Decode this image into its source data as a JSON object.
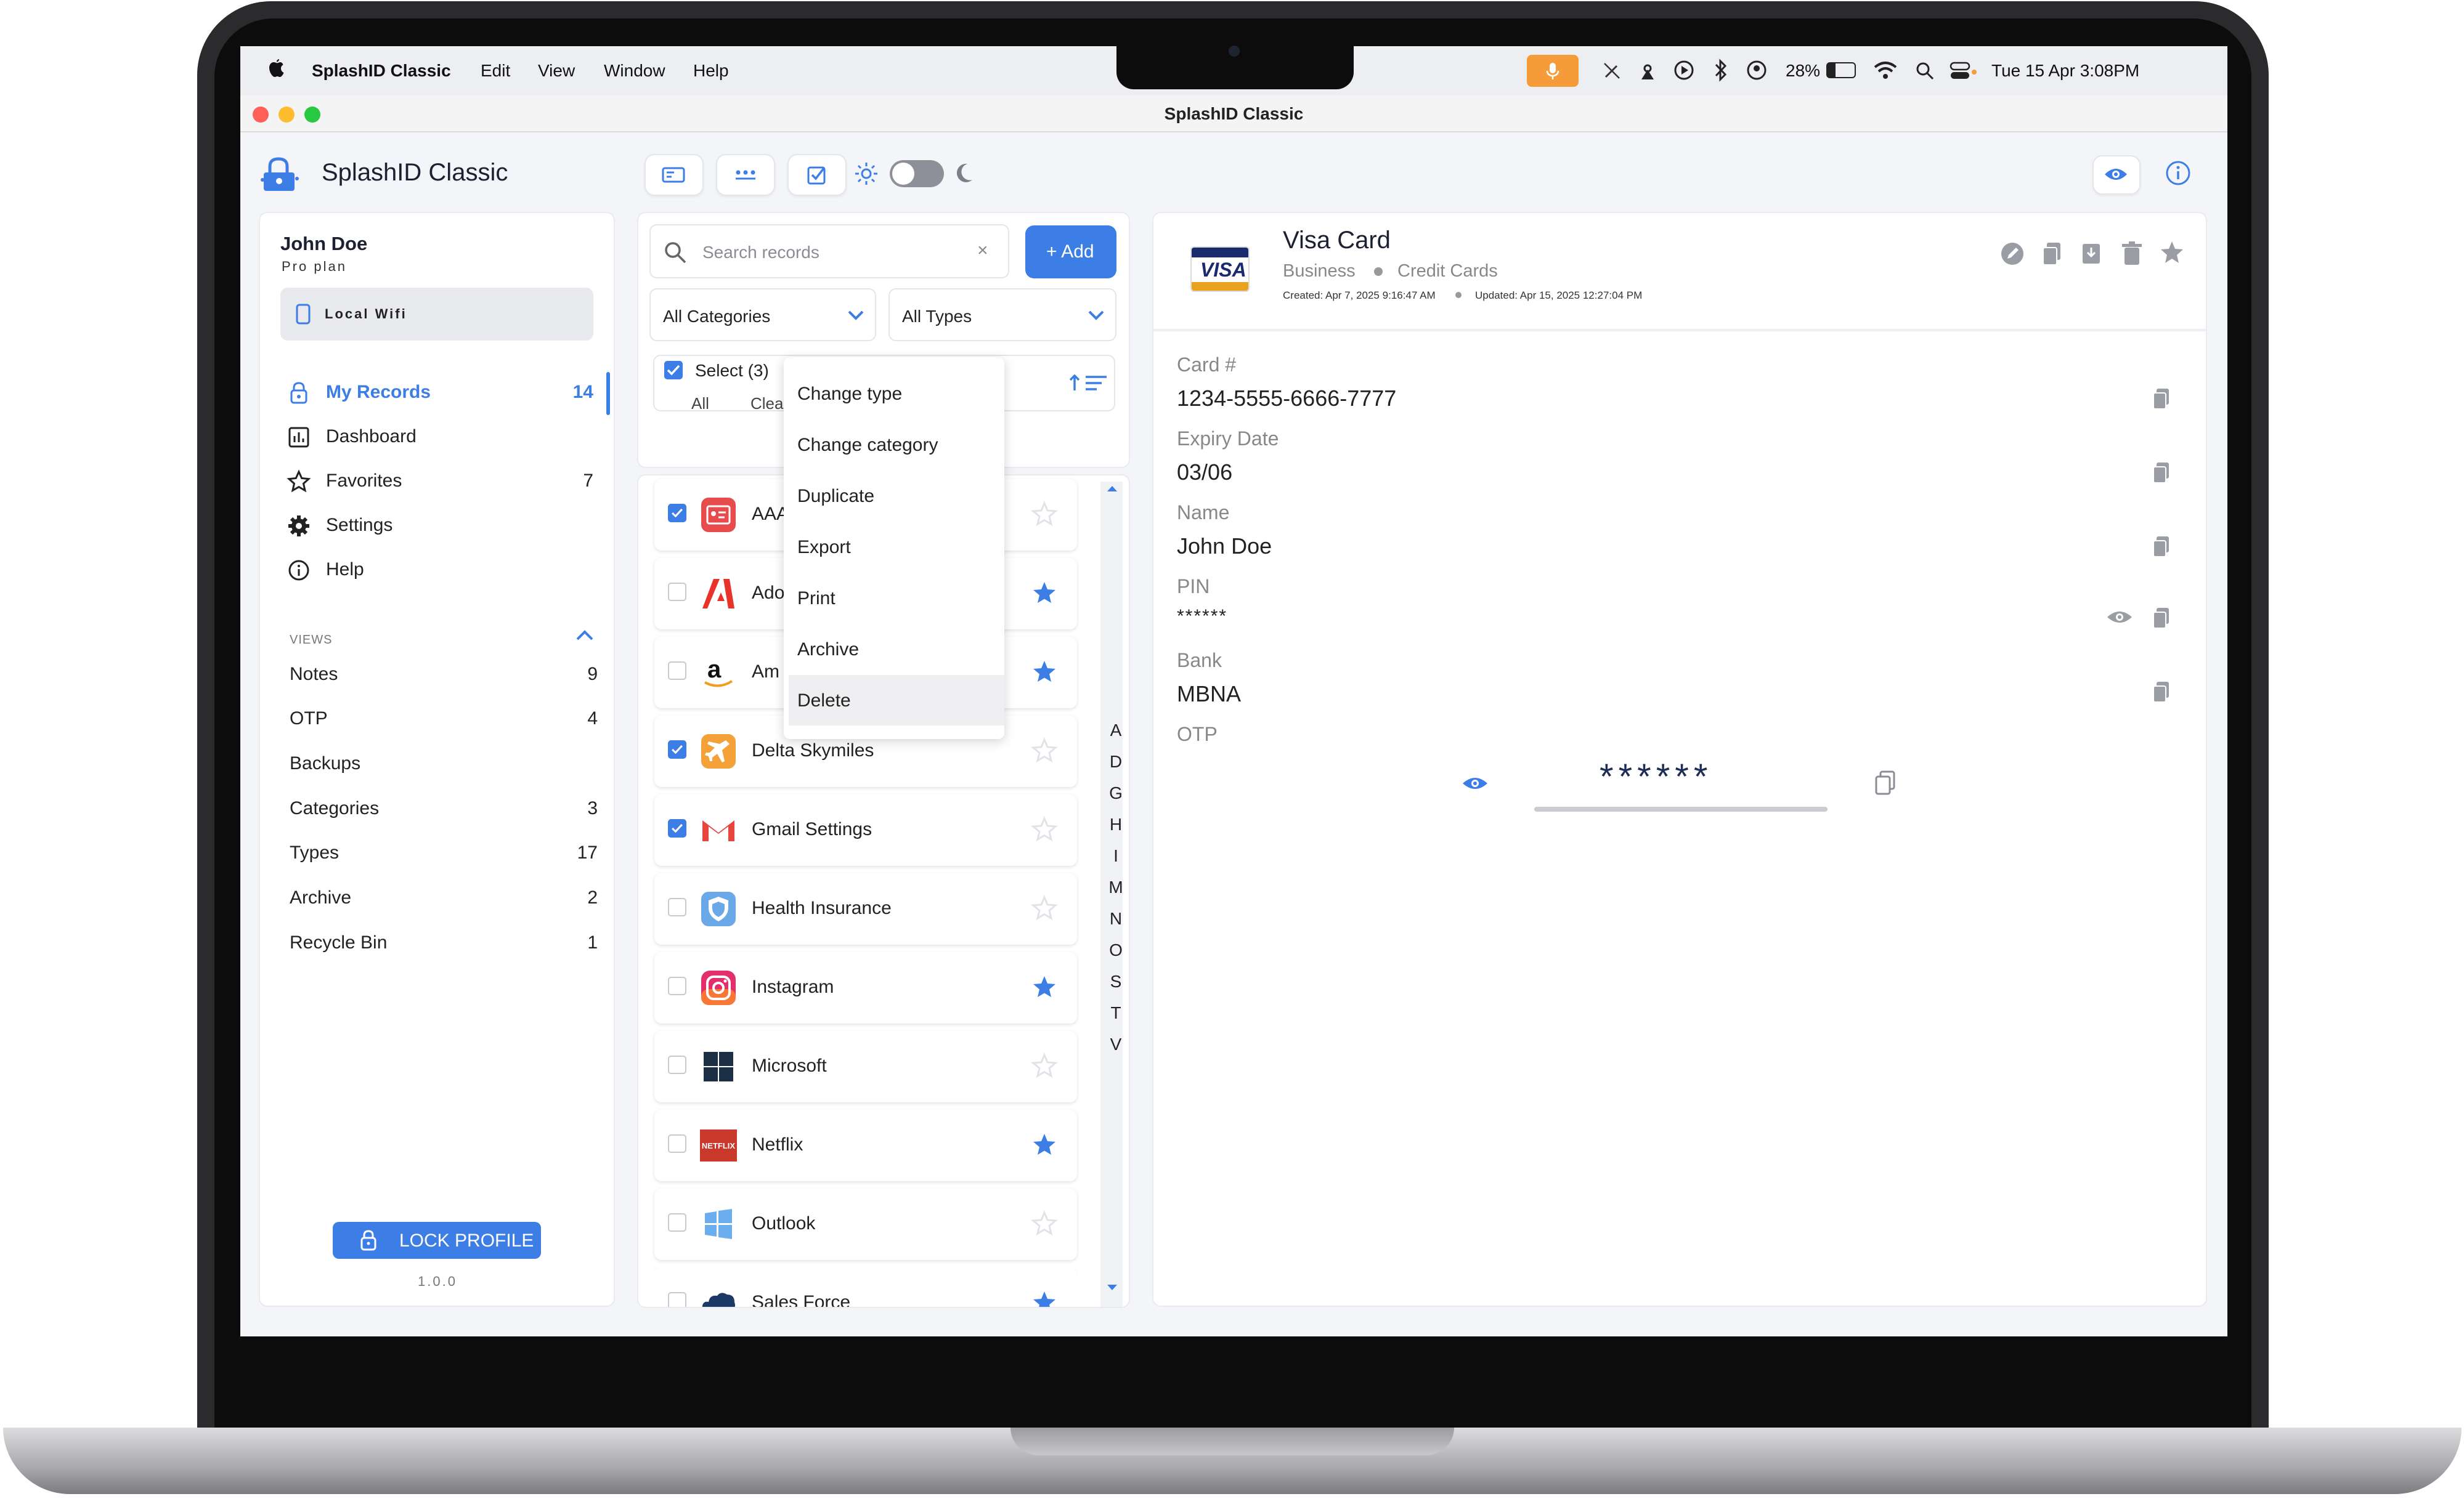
{
  "menubar": {
    "app_name": "SplashID Classic",
    "menus": [
      "Edit",
      "View",
      "Window",
      "Help"
    ],
    "battery": "28%",
    "datetime": "Tue 15 Apr  3:08PM"
  },
  "window": {
    "title": "SplashID Classic"
  },
  "header": {
    "app_title": "SplashID Classic"
  },
  "sidebar": {
    "user_name": "John Doe",
    "plan": "Pro plan",
    "vault": "Local Wifi",
    "nav": [
      {
        "label": "My Records",
        "count": "14"
      },
      {
        "label": "Dashboard",
        "count": ""
      },
      {
        "label": "Favorites",
        "count": "7"
      },
      {
        "label": "Settings",
        "count": ""
      },
      {
        "label": "Help",
        "count": ""
      }
    ],
    "views_header": "VIEWS",
    "views": [
      {
        "label": "Notes",
        "count": "9"
      },
      {
        "label": "OTP",
        "count": "4"
      },
      {
        "label": "Backups",
        "count": ""
      },
      {
        "label": "Categories",
        "count": "3"
      },
      {
        "label": "Types",
        "count": "17"
      },
      {
        "label": "Archive",
        "count": "2"
      },
      {
        "label": "Recycle Bin",
        "count": "1"
      }
    ],
    "lock_button": "LOCK PROFILE",
    "version": "1.0.0"
  },
  "list": {
    "search_placeholder": "Search records",
    "add_button": "+ Add",
    "category_filter": "All Categories",
    "type_filter": "All Types",
    "select_label": "Select (3)",
    "select_all": "All",
    "clear": "Clea",
    "records": [
      {
        "name": "AAA",
        "checked": true,
        "fav": false
      },
      {
        "name": "Ado",
        "checked": false,
        "fav": true
      },
      {
        "name": "Am",
        "checked": false,
        "fav": true
      },
      {
        "name": "Delta Skymiles",
        "checked": true,
        "fav": false
      },
      {
        "name": "Gmail Settings",
        "checked": true,
        "fav": false
      },
      {
        "name": "Health Insurance",
        "checked": false,
        "fav": false
      },
      {
        "name": "Instagram",
        "checked": false,
        "fav": true
      },
      {
        "name": "Microsoft",
        "checked": false,
        "fav": false
      },
      {
        "name": "Netflix",
        "checked": false,
        "fav": true
      },
      {
        "name": "Outlook",
        "checked": false,
        "fav": false
      },
      {
        "name": "Sales Force",
        "checked": false,
        "fav": true
      }
    ],
    "alphabet": [
      "A",
      "D",
      "G",
      "H",
      "I",
      "M",
      "N",
      "O",
      "S",
      "T",
      "V"
    ]
  },
  "context_menu": {
    "items": [
      "Change type",
      "Change category",
      "Duplicate",
      "Export",
      "Print",
      "Archive",
      "Delete"
    ]
  },
  "detail": {
    "title": "Visa Card",
    "logo_text": "VISA",
    "category": "Business",
    "type": "Credit Cards",
    "created": "Created: Apr 7, 2025 9:16:47 AM",
    "updated": "Updated: Apr 15, 2025 12:27:04 PM",
    "fields": [
      {
        "label": "Card #",
        "value": "1234-5555-6666-7777"
      },
      {
        "label": "Expiry Date",
        "value": "03/06"
      },
      {
        "label": "Name",
        "value": "John Doe"
      },
      {
        "label": "PIN",
        "value": "******"
      },
      {
        "label": "Bank",
        "value": "MBNA"
      }
    ],
    "otp_label": "OTP",
    "otp_value": "******"
  },
  "colors": {
    "accent": "#3d7ee6",
    "brand_dark": "#1d2c55"
  }
}
